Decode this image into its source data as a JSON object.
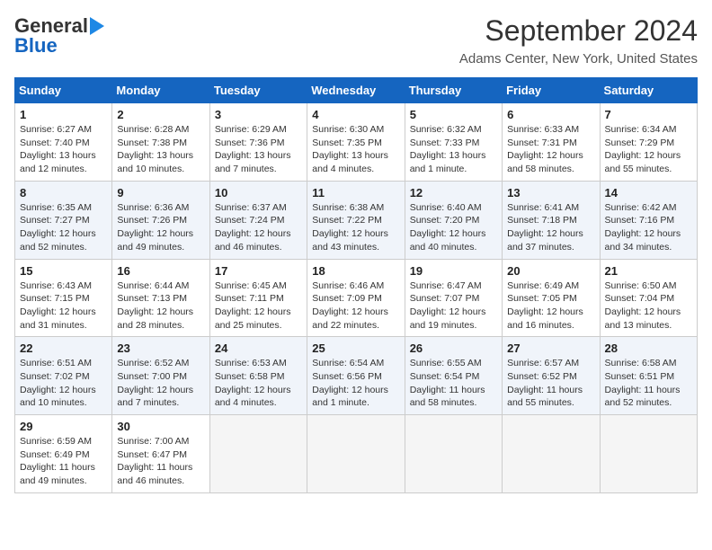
{
  "header": {
    "logo_line1": "General",
    "logo_line2": "Blue",
    "title": "September 2024",
    "subtitle": "Adams Center, New York, United States"
  },
  "weekdays": [
    "Sunday",
    "Monday",
    "Tuesday",
    "Wednesday",
    "Thursday",
    "Friday",
    "Saturday"
  ],
  "weeks": [
    [
      {
        "day": "1",
        "info": "Sunrise: 6:27 AM\nSunset: 7:40 PM\nDaylight: 13 hours\nand 12 minutes."
      },
      {
        "day": "2",
        "info": "Sunrise: 6:28 AM\nSunset: 7:38 PM\nDaylight: 13 hours\nand 10 minutes."
      },
      {
        "day": "3",
        "info": "Sunrise: 6:29 AM\nSunset: 7:36 PM\nDaylight: 13 hours\nand 7 minutes."
      },
      {
        "day": "4",
        "info": "Sunrise: 6:30 AM\nSunset: 7:35 PM\nDaylight: 13 hours\nand 4 minutes."
      },
      {
        "day": "5",
        "info": "Sunrise: 6:32 AM\nSunset: 7:33 PM\nDaylight: 13 hours\nand 1 minute."
      },
      {
        "day": "6",
        "info": "Sunrise: 6:33 AM\nSunset: 7:31 PM\nDaylight: 12 hours\nand 58 minutes."
      },
      {
        "day": "7",
        "info": "Sunrise: 6:34 AM\nSunset: 7:29 PM\nDaylight: 12 hours\nand 55 minutes."
      }
    ],
    [
      {
        "day": "8",
        "info": "Sunrise: 6:35 AM\nSunset: 7:27 PM\nDaylight: 12 hours\nand 52 minutes."
      },
      {
        "day": "9",
        "info": "Sunrise: 6:36 AM\nSunset: 7:26 PM\nDaylight: 12 hours\nand 49 minutes."
      },
      {
        "day": "10",
        "info": "Sunrise: 6:37 AM\nSunset: 7:24 PM\nDaylight: 12 hours\nand 46 minutes."
      },
      {
        "day": "11",
        "info": "Sunrise: 6:38 AM\nSunset: 7:22 PM\nDaylight: 12 hours\nand 43 minutes."
      },
      {
        "day": "12",
        "info": "Sunrise: 6:40 AM\nSunset: 7:20 PM\nDaylight: 12 hours\nand 40 minutes."
      },
      {
        "day": "13",
        "info": "Sunrise: 6:41 AM\nSunset: 7:18 PM\nDaylight: 12 hours\nand 37 minutes."
      },
      {
        "day": "14",
        "info": "Sunrise: 6:42 AM\nSunset: 7:16 PM\nDaylight: 12 hours\nand 34 minutes."
      }
    ],
    [
      {
        "day": "15",
        "info": "Sunrise: 6:43 AM\nSunset: 7:15 PM\nDaylight: 12 hours\nand 31 minutes."
      },
      {
        "day": "16",
        "info": "Sunrise: 6:44 AM\nSunset: 7:13 PM\nDaylight: 12 hours\nand 28 minutes."
      },
      {
        "day": "17",
        "info": "Sunrise: 6:45 AM\nSunset: 7:11 PM\nDaylight: 12 hours\nand 25 minutes."
      },
      {
        "day": "18",
        "info": "Sunrise: 6:46 AM\nSunset: 7:09 PM\nDaylight: 12 hours\nand 22 minutes."
      },
      {
        "day": "19",
        "info": "Sunrise: 6:47 AM\nSunset: 7:07 PM\nDaylight: 12 hours\nand 19 minutes."
      },
      {
        "day": "20",
        "info": "Sunrise: 6:49 AM\nSunset: 7:05 PM\nDaylight: 12 hours\nand 16 minutes."
      },
      {
        "day": "21",
        "info": "Sunrise: 6:50 AM\nSunset: 7:04 PM\nDaylight: 12 hours\nand 13 minutes."
      }
    ],
    [
      {
        "day": "22",
        "info": "Sunrise: 6:51 AM\nSunset: 7:02 PM\nDaylight: 12 hours\nand 10 minutes."
      },
      {
        "day": "23",
        "info": "Sunrise: 6:52 AM\nSunset: 7:00 PM\nDaylight: 12 hours\nand 7 minutes."
      },
      {
        "day": "24",
        "info": "Sunrise: 6:53 AM\nSunset: 6:58 PM\nDaylight: 12 hours\nand 4 minutes."
      },
      {
        "day": "25",
        "info": "Sunrise: 6:54 AM\nSunset: 6:56 PM\nDaylight: 12 hours\nand 1 minute."
      },
      {
        "day": "26",
        "info": "Sunrise: 6:55 AM\nSunset: 6:54 PM\nDaylight: 11 hours\nand 58 minutes."
      },
      {
        "day": "27",
        "info": "Sunrise: 6:57 AM\nSunset: 6:52 PM\nDaylight: 11 hours\nand 55 minutes."
      },
      {
        "day": "28",
        "info": "Sunrise: 6:58 AM\nSunset: 6:51 PM\nDaylight: 11 hours\nand 52 minutes."
      }
    ],
    [
      {
        "day": "29",
        "info": "Sunrise: 6:59 AM\nSunset: 6:49 PM\nDaylight: 11 hours\nand 49 minutes."
      },
      {
        "day": "30",
        "info": "Sunrise: 7:00 AM\nSunset: 6:47 PM\nDaylight: 11 hours\nand 46 minutes."
      },
      {
        "day": "",
        "info": ""
      },
      {
        "day": "",
        "info": ""
      },
      {
        "day": "",
        "info": ""
      },
      {
        "day": "",
        "info": ""
      },
      {
        "day": "",
        "info": ""
      }
    ]
  ]
}
